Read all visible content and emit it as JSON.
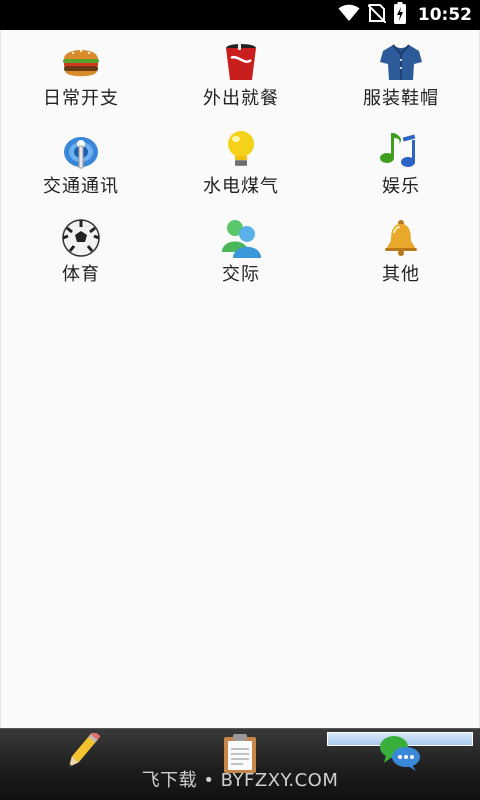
{
  "status_bar": {
    "time": "10:52",
    "icons": [
      "wifi-icon",
      "no-sim-icon",
      "battery-charging-icon"
    ]
  },
  "categories": [
    {
      "label": "日常开支",
      "icon": "burger-icon"
    },
    {
      "label": "外出就餐",
      "icon": "soda-cup-icon"
    },
    {
      "label": "服装鞋帽",
      "icon": "shirt-icon"
    },
    {
      "label": "交通通讯",
      "icon": "antenna-icon"
    },
    {
      "label": "水电煤气",
      "icon": "lightbulb-icon"
    },
    {
      "label": "娱乐",
      "icon": "music-notes-icon"
    },
    {
      "label": "体育",
      "icon": "soccer-ball-icon"
    },
    {
      "label": "交际",
      "icon": "people-icon"
    },
    {
      "label": "其他",
      "icon": "bell-icon"
    }
  ],
  "bottom_tabs": [
    {
      "icon": "pencil-icon"
    },
    {
      "icon": "clipboard-icon"
    },
    {
      "icon": "chat-bubbles-icon",
      "selected": true
    }
  ],
  "watermark": "飞下载 • BYFZXY.COM"
}
